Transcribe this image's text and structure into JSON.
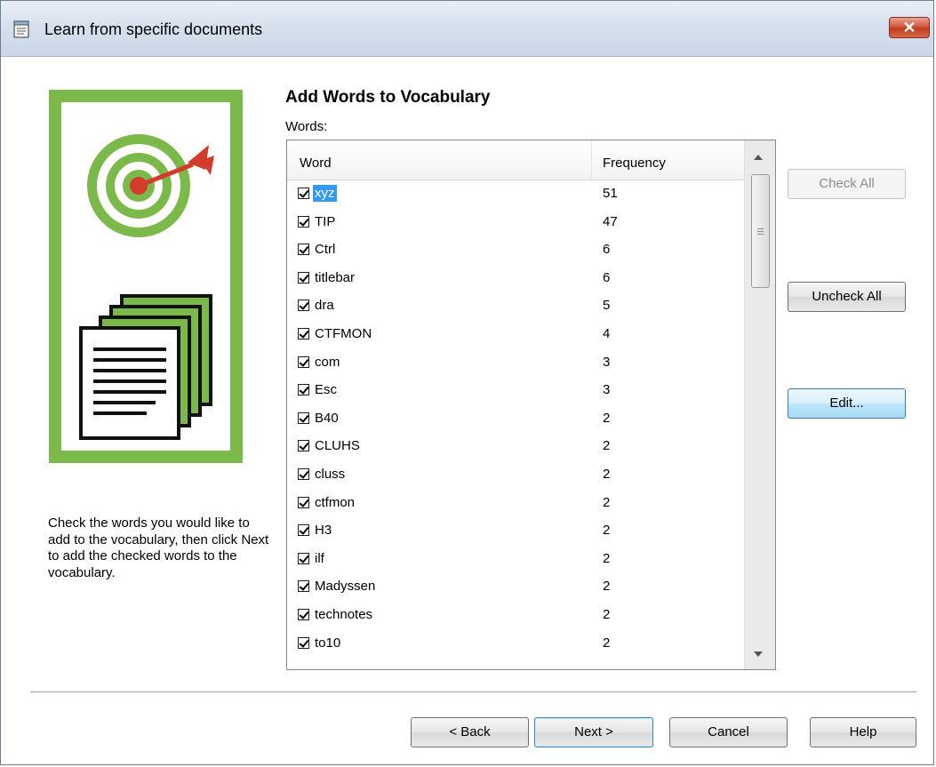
{
  "window": {
    "title": "Learn from specific documents"
  },
  "main": {
    "heading": "Add Words to Vocabulary",
    "words_label": "Words:",
    "columns": {
      "word": "Word",
      "frequency": "Frequency"
    },
    "rows": [
      {
        "word": "xyz",
        "frequency": "51",
        "checked": true,
        "selected": true
      },
      {
        "word": "TIP",
        "frequency": "47",
        "checked": true
      },
      {
        "word": "Ctrl",
        "frequency": "6",
        "checked": true
      },
      {
        "word": "titlebar",
        "frequency": "6",
        "checked": true
      },
      {
        "word": "dra",
        "frequency": "5",
        "checked": true
      },
      {
        "word": "CTFMON",
        "frequency": "4",
        "checked": true
      },
      {
        "word": "com",
        "frequency": "3",
        "checked": true
      },
      {
        "word": "Esc",
        "frequency": "3",
        "checked": true
      },
      {
        "word": "B40",
        "frequency": "2",
        "checked": true
      },
      {
        "word": "CLUHS",
        "frequency": "2",
        "checked": true
      },
      {
        "word": "cluss",
        "frequency": "2",
        "checked": true
      },
      {
        "word": "ctfmon",
        "frequency": "2",
        "checked": true
      },
      {
        "word": "H3",
        "frequency": "2",
        "checked": true
      },
      {
        "word": "ilf",
        "frequency": "2",
        "checked": true
      },
      {
        "word": "Madyssen",
        "frequency": "2",
        "checked": true
      },
      {
        "word": "technotes",
        "frequency": "2",
        "checked": true
      },
      {
        "word": "to10",
        "frequency": "2",
        "checked": true
      }
    ]
  },
  "side_buttons": {
    "check_all": "Check All",
    "uncheck_all": "Uncheck All",
    "edit": "Edit..."
  },
  "instructions": "Check the words you would like to add to the vocabulary, then click Next to add the checked words to the vocabulary.",
  "footer": {
    "back": "< Back",
    "next": "Next >",
    "cancel": "Cancel",
    "help": "Help"
  },
  "colors": {
    "art_green": "#7ab94a",
    "selection": "#3399ff",
    "dart_red": "#d23c2c"
  }
}
